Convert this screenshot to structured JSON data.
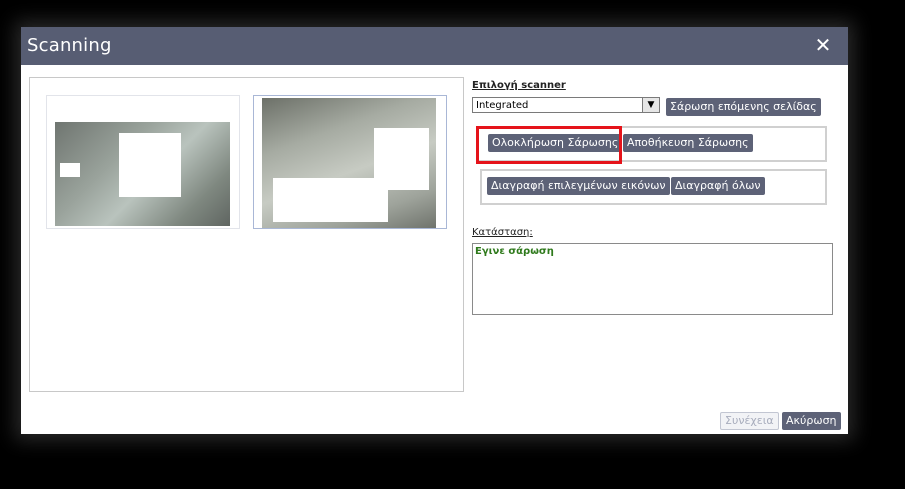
{
  "window": {
    "title": "Scanning",
    "close_icon": "close-icon"
  },
  "scanner": {
    "label": "Επιλογή scanner",
    "selected": "Integrated",
    "next_page_button": "Σάρωση επόμενης σελίδας"
  },
  "actions": {
    "complete_scan": "Ολοκλήρωση Σάρωσης",
    "save_scan": "Αποθήκευση Σάρωσης",
    "delete_selected": "Διαγραφή επιλεγμένων εικόνων",
    "delete_all": "Διαγραφή όλων"
  },
  "status": {
    "label": "Κατάσταση:",
    "message": "Εγινε σάρωση"
  },
  "footer": {
    "continue_button": "Συνέχεια",
    "cancel_button": "Ακύρωση"
  },
  "colors": {
    "titlebar": "#575d73",
    "button": "#5d6277",
    "highlight": "#e5131a",
    "status_text": "#2f7a1c"
  }
}
